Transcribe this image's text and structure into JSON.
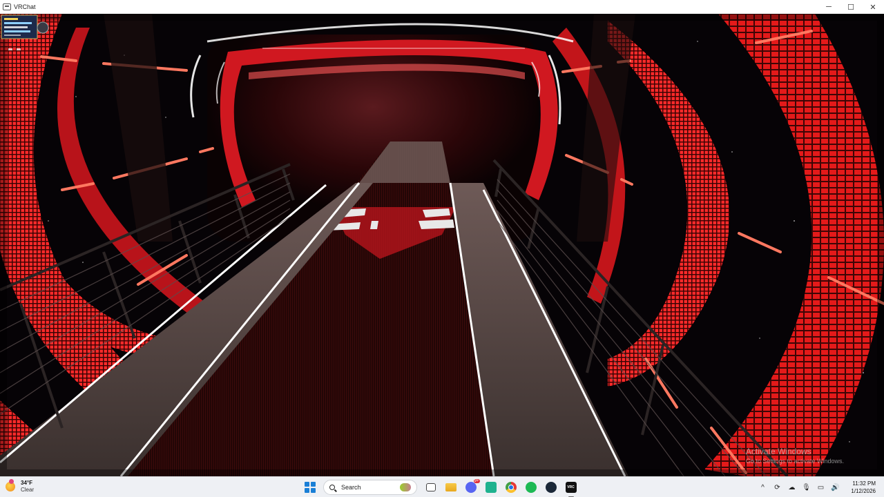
{
  "window": {
    "title": "VRChat",
    "controls": {
      "minimize": "─",
      "maximize": "☐",
      "close": "✕"
    }
  },
  "watermark": {
    "line1": "Activate Windows",
    "line2": "Go to Settings to activate Windows."
  },
  "taskbar": {
    "weather": {
      "temp": "34°F",
      "condition": "Clear"
    },
    "search": {
      "label": "Search"
    },
    "apps": [
      {
        "name": "start-icon"
      },
      {
        "name": "search-box"
      },
      {
        "name": "task-view-icon"
      },
      {
        "name": "file-explorer-icon"
      },
      {
        "name": "discord-icon",
        "badge": "9+"
      },
      {
        "name": "feed-icon"
      },
      {
        "name": "chrome-icon"
      },
      {
        "name": "spotify-icon"
      },
      {
        "name": "steam-icon"
      },
      {
        "name": "vrchat-icon",
        "label": "VRC"
      }
    ],
    "tray": {
      "chevron": "^"
    },
    "clock": {
      "time": "11:32 PM",
      "date": "1/12/2026"
    }
  },
  "colors": {
    "accent_red": "#e0141e",
    "led_red": "#ff2b2b",
    "taskbar_bg": "#eef0f4",
    "space_bg": "#050305"
  }
}
